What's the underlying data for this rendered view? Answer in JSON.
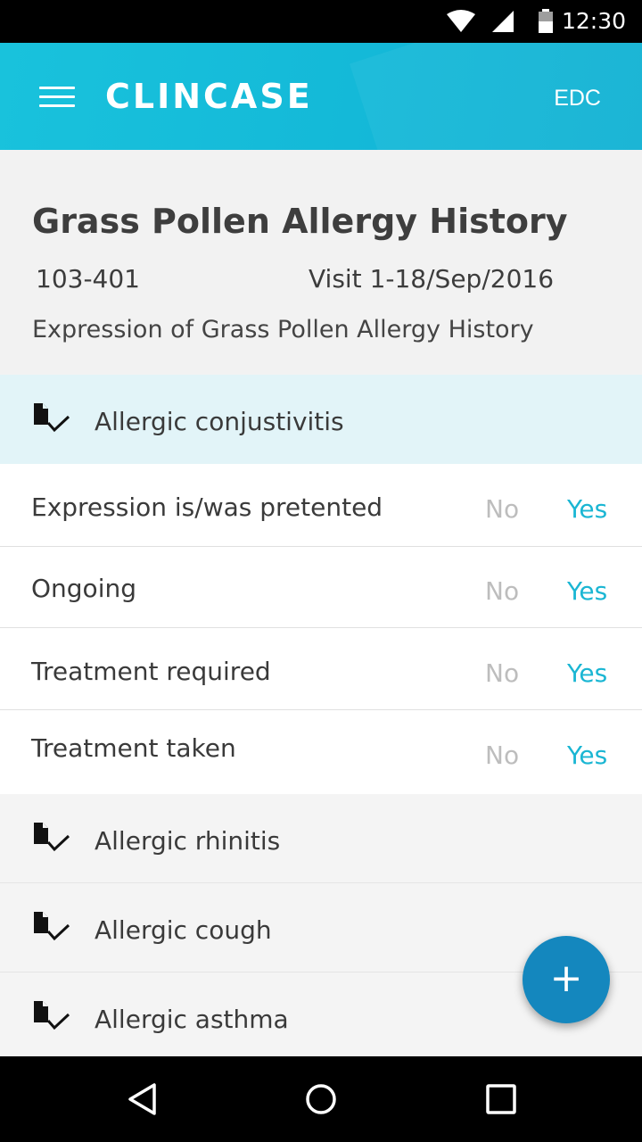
{
  "status_bar": {
    "time": "12:30"
  },
  "app_bar": {
    "brand": "CLINCASE",
    "action": "EDC"
  },
  "form": {
    "title": "Grass Pollen Allergy History",
    "subject_id": "103-401",
    "visit": "Visit 1-18/Sep/2016",
    "description": "Expression of Grass Pollen Allergy History"
  },
  "sections": [
    {
      "label": "Allergic conjustivitis",
      "expanded": true
    },
    {
      "label": "Allergic rhinitis",
      "expanded": false
    },
    {
      "label": "Allergic cough",
      "expanded": false
    },
    {
      "label": "Allergic asthma",
      "expanded": false
    }
  ],
  "questions": [
    {
      "label": "Expression is/was pretented",
      "no": "No",
      "yes": "Yes"
    },
    {
      "label": "Ongoing",
      "no": "No",
      "yes": "Yes"
    },
    {
      "label": "Treatment required",
      "no": "No",
      "yes": "Yes"
    },
    {
      "label": "Treatment taken",
      "no": "No",
      "yes": "Yes"
    }
  ],
  "fab": {
    "symbol": "+"
  },
  "colors": {
    "accent": "#1ab6d3",
    "fab": "#1487be",
    "muted_option": "#bdbdbd"
  },
  "icons": [
    "wifi-icon",
    "cell-signal-icon",
    "battery-icon",
    "menu-icon",
    "document-check-icon",
    "add-icon",
    "back-icon",
    "home-icon",
    "recents-icon"
  ]
}
